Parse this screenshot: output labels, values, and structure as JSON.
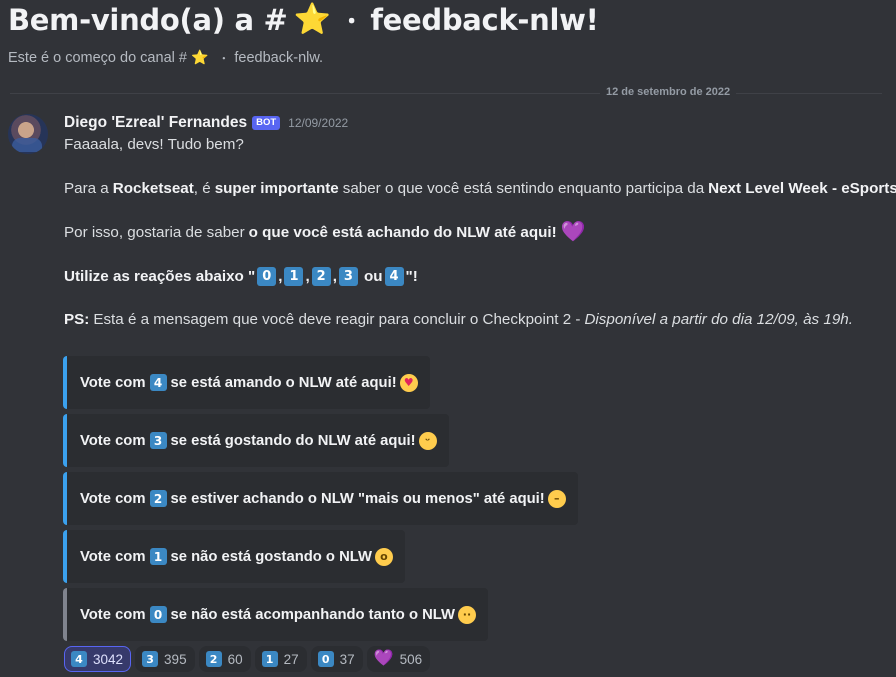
{
  "welcome": {
    "title_prefix": "Bem-vindo(a) a #",
    "title_star": "⭐",
    "title_dot": "・",
    "title_channel": "feedback-nlw!",
    "sub_prefix": "Este é o começo do canal #",
    "sub_star": "⭐",
    "sub_dot": "・",
    "sub_channel": "feedback-nlw."
  },
  "date_divider": "12 de setembro de 2022",
  "message": {
    "author": "Diego 'Ezreal' Fernandes",
    "bot_tag": "BOT",
    "timestamp": "12/09/2022",
    "greeting": "Faaaala, devs! Tudo bem?",
    "p1": {
      "a": "Para a",
      "b": "Rocketseat",
      "c": ", é",
      "d": "super importante",
      "e": "saber o que você está sentindo enquanto participa da",
      "f": "Next Level Week - eSports."
    },
    "p2": {
      "a": "Por isso, gostaria de saber",
      "b": "o que você está achando do NLW até aqui!",
      "heart": "💜"
    },
    "p3": {
      "a": "Utilize as reações abaixo \"",
      "keys": [
        "0",
        "1",
        "2",
        "3",
        "4"
      ],
      "sep": ",",
      "ou": "ou",
      "end": "\"!"
    },
    "p4": {
      "a": "PS:",
      "b": "Esta é a mensagem que você deve reagir para concluir o Checkpoint 2 -",
      "c": "Disponível a partir do dia 12/09, às 19h."
    }
  },
  "embeds": [
    {
      "prefix": "Vote com",
      "key": "4",
      "text": "se está amando o NLW até aqui!",
      "emoji": "😍",
      "emoji_glyph": "♥"
    },
    {
      "prefix": "Vote com",
      "key": "3",
      "text": "se está gostando do NLW até aqui!",
      "emoji": "😄",
      "emoji_glyph": "ᵕ"
    },
    {
      "prefix": "Vote com",
      "key": "2",
      "text": "se estiver achando o NLW \"mais ou menos\" até aqui!",
      "emoji": "😐",
      "emoji_glyph": "–"
    },
    {
      "prefix": "Vote com",
      "key": "1",
      "text": "se não está gostando o NLW",
      "emoji": "🥱",
      "emoji_glyph": "o"
    },
    {
      "prefix": "Vote com",
      "key": "0",
      "text": "se não está acompanhando tanto o NLW",
      "emoji": "😶",
      "emoji_glyph": "··"
    }
  ],
  "reactions": [
    {
      "emoji": "4",
      "count": "3042"
    },
    {
      "emoji": "3",
      "count": "395"
    },
    {
      "emoji": "2",
      "count": "60"
    },
    {
      "emoji": "1",
      "count": "27"
    },
    {
      "emoji": "0",
      "count": "37"
    },
    {
      "emoji": "💜",
      "count": "506"
    }
  ],
  "colors": {
    "background": "#313338",
    "embed_bg": "#2b2d31",
    "embed_accent": "#3ba1ee",
    "embed_accent_grey": "#80848e",
    "keycap": "#3b88c3",
    "bot_tag": "#5865f2",
    "heart": "#aa8ed6",
    "star": "#f5c431"
  }
}
